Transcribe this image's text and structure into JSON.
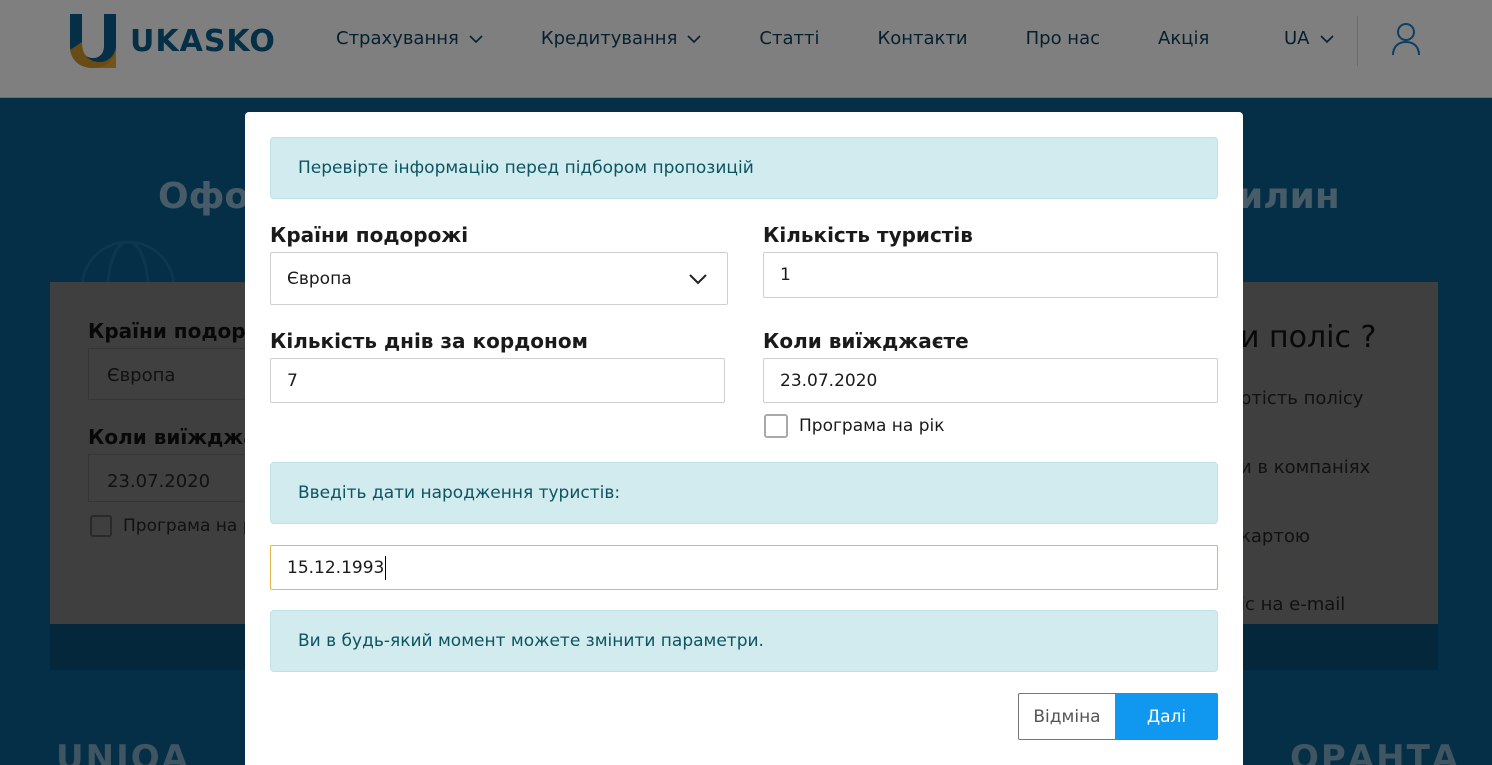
{
  "header": {
    "brand": "UKASKO",
    "nav": [
      {
        "label": "Страхування",
        "has_dropdown": true
      },
      {
        "label": "Кредитування",
        "has_dropdown": true
      },
      {
        "label": "Статті",
        "has_dropdown": false
      },
      {
        "label": "Контакти",
        "has_dropdown": false
      },
      {
        "label": "Про нас",
        "has_dropdown": false
      },
      {
        "label": "Акція",
        "has_dropdown": false
      }
    ],
    "language": "UA"
  },
  "background": {
    "title_left": "Офор",
    "title_right": "илин",
    "countries_label": "Країни подорож",
    "countries_value": "Європа",
    "departure_label": "Коли виїжджає",
    "departure_value": "23.07.2020",
    "year_program_label": "Програма на р",
    "right_title": "и поліс ?",
    "right_items": [
      "ртість полісу",
      "и в компаніях",
      "картою",
      "іс на e-mail"
    ],
    "partner_left": "UNIQA",
    "partner_right": "ОРАНТА"
  },
  "modal": {
    "info_top": "Перевірте інформацію перед підбором пропозицій",
    "countries_label": "Країни подорожі",
    "countries_value": "Європа",
    "tourists_label": "Кількість туристів",
    "tourists_value": "1",
    "days_label": "Кількість днів за кордоном",
    "days_value": "7",
    "departure_label": "Коли виїжджаєте",
    "departure_value": "23.07.2020",
    "year_program_label": "Програма на рік",
    "year_program_checked": false,
    "birthdates_info": "Введіть дати народження туристів:",
    "birthdate_value": "15.12.1993",
    "change_info": "Ви в будь-який момент можете змінити параметри.",
    "cancel_label": "Відміна",
    "next_label": "Далі"
  },
  "colors": {
    "accent": "#1098f0",
    "info_bg": "#d1ebef",
    "info_text": "#0c5460",
    "focus_border": "#e8b64c",
    "brand_blue": "#0a5e8c",
    "brand_orange": "#e8a020"
  }
}
